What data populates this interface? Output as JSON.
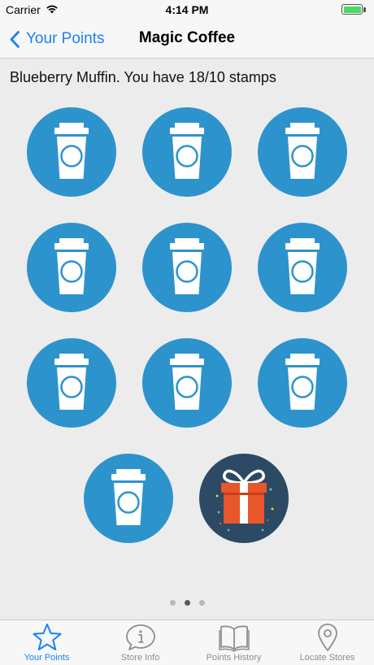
{
  "status_bar": {
    "carrier": "Carrier",
    "time": "4:14 PM"
  },
  "nav": {
    "back_label": "Your Points",
    "title": "Magic Coffee"
  },
  "summary": "Blueberry Muffin. You have 18/10 stamps",
  "stamps": {
    "filled": 10,
    "reward_icon": "gift-icon",
    "stamp_icon": "coffee-cup-icon"
  },
  "pagination": {
    "pages": 3,
    "current": 2
  },
  "tabs": [
    {
      "label": "Your Points",
      "icon": "star-icon",
      "active": true
    },
    {
      "label": "Store Info",
      "icon": "info-icon",
      "active": false
    },
    {
      "label": "Points History",
      "icon": "book-icon",
      "active": false
    },
    {
      "label": "Locate Stores",
      "icon": "location-pin-icon",
      "active": false
    }
  ],
  "colors": {
    "accent": "#1a82f2",
    "stamp": "#2d93cd",
    "gift_bg": "#2d4a64",
    "gift_box": "#e8562a"
  }
}
